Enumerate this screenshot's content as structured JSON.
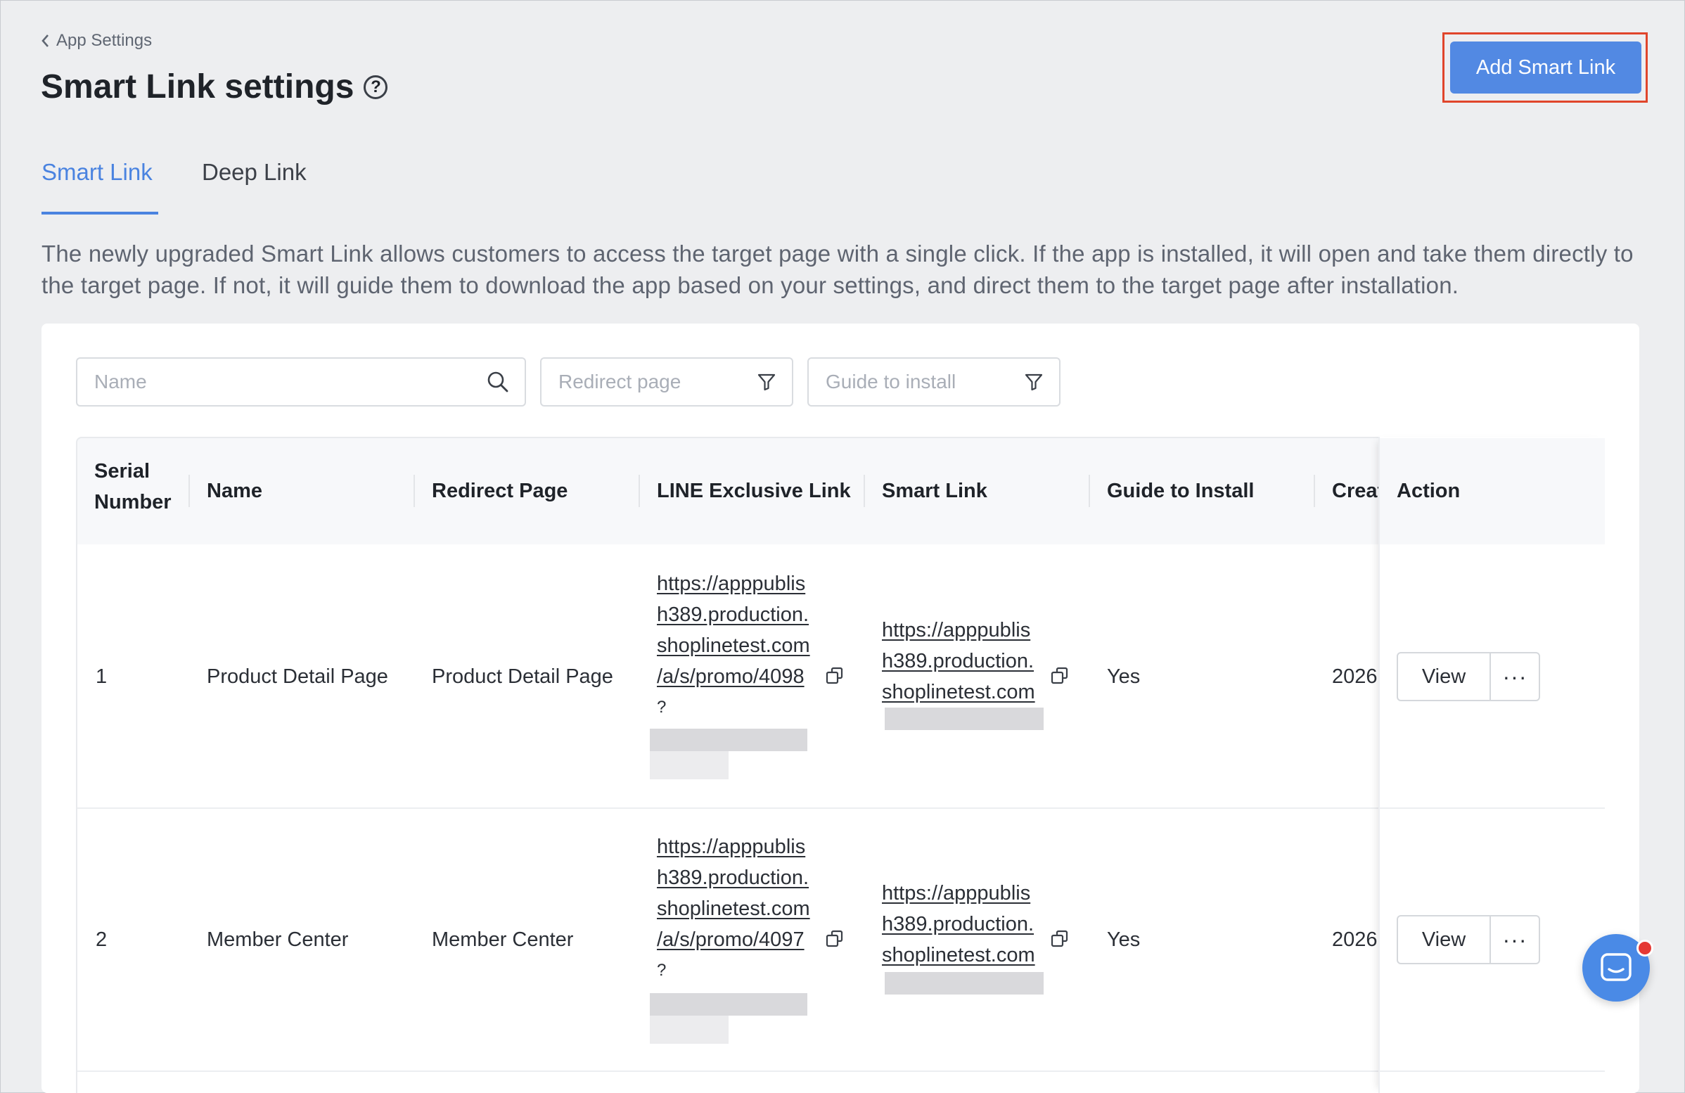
{
  "header": {
    "back_label": "App Settings",
    "title": "Smart Link settings",
    "help_icon": "help-circle-icon",
    "add_button": "Add Smart Link"
  },
  "tabs": [
    {
      "label": "Smart Link",
      "active": true
    },
    {
      "label": "Deep Link",
      "active": false
    }
  ],
  "description": "The newly upgraded Smart Link allows customers to access the target page with a single click. If the app is installed, it will open and take them directly to the target page. If not, it will guide them to download the app based on your settings, and direct them to the target page after installation.",
  "filters": {
    "name_placeholder": "Name",
    "redirect_placeholder": "Redirect page",
    "guide_placeholder": "Guide to install"
  },
  "table": {
    "columns": {
      "serial_line1": "Serial",
      "serial_line2": "Number",
      "name": "Name",
      "redirect": "Redirect Page",
      "line_link": "LINE Exclusive Link",
      "smart_link": "Smart Link",
      "guide": "Guide to Install",
      "created": "Creat",
      "action": "Action"
    },
    "rows": [
      {
        "serial": "1",
        "name": "Product Detail Page",
        "redirect": "Product Detail Page",
        "line_link_lines": [
          "https://apppublis",
          "h389.production.",
          "shoplinetest.com",
          "/a/s/promo/4098",
          "?"
        ],
        "smart_link_lines": [
          "https://apppublis",
          "h389.production.",
          "shoplinetest.com"
        ],
        "guide": "Yes",
        "created": "2026",
        "view_label": "View",
        "more_label": "···"
      },
      {
        "serial": "2",
        "name": "Member Center",
        "redirect": "Member Center",
        "line_link_lines": [
          "https://apppublis",
          "h389.production.",
          "shoplinetest.com",
          "/a/s/promo/4097",
          "?"
        ],
        "smart_link_lines": [
          "https://apppublis",
          "h389.production.",
          "shoplinetest.com"
        ],
        "guide": "Yes",
        "created": "2026",
        "view_label": "View",
        "more_label": "···"
      }
    ]
  },
  "colors": {
    "accent": "#4a83e0",
    "primary_button": "#5289e3",
    "highlight_border": "#e0452b"
  }
}
